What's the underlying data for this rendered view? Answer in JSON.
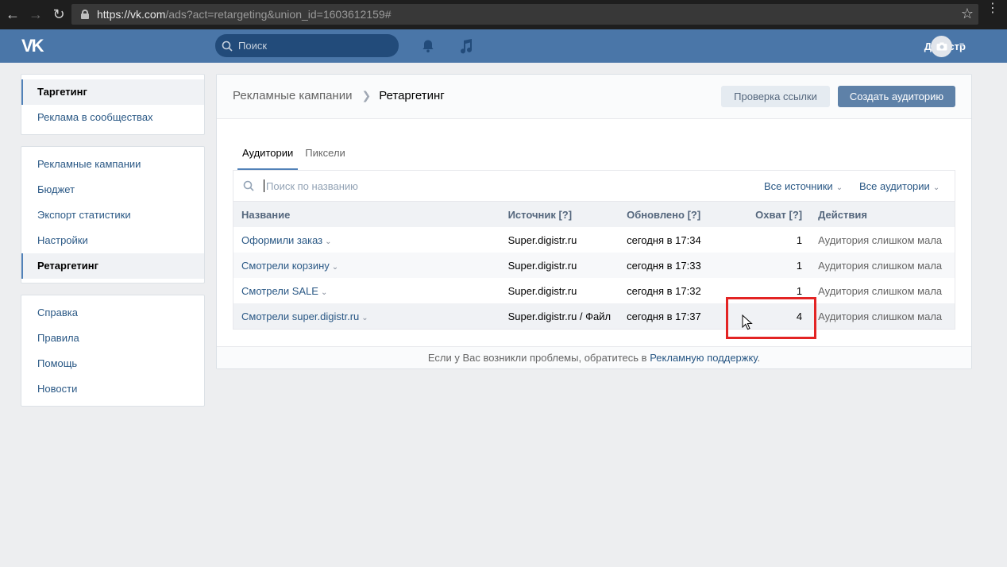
{
  "browser": {
    "url_host": "https://vk.com",
    "url_rest": "/ads?act=retargeting&union_id=1603612159#"
  },
  "header": {
    "logo": "VK",
    "search_placeholder": "Поиск",
    "user_name": "Дигистр"
  },
  "sidebar": {
    "block1": [
      {
        "label": "Таргетинг",
        "active": true
      },
      {
        "label": "Реклама в сообществах",
        "active": false
      }
    ],
    "block2": [
      {
        "label": "Рекламные кампании",
        "active": false
      },
      {
        "label": "Бюджет",
        "active": false
      },
      {
        "label": "Экспорт статистики",
        "active": false
      },
      {
        "label": "Настройки",
        "active": false
      },
      {
        "label": "Ретаргетинг",
        "active": true
      }
    ],
    "block3": [
      {
        "label": "Справка"
      },
      {
        "label": "Правила"
      },
      {
        "label": "Помощь"
      },
      {
        "label": "Новости"
      }
    ]
  },
  "main": {
    "breadcrumb_parent": "Рекламные кампании",
    "breadcrumb_current": "Ретаргетинг",
    "check_link_button": "Проверка ссылки",
    "create_audience_button": "Создать аудиторию",
    "tabs": [
      {
        "label": "Аудитории",
        "active": true
      },
      {
        "label": "Пиксели",
        "active": false
      }
    ],
    "search_placeholder": "Поиск по названию",
    "filter_sources": "Все источники",
    "filter_audiences": "Все аудитории",
    "columns": {
      "name": "Название",
      "source": "Источник [?]",
      "updated": "Обновлено [?]",
      "reach": "Охват [?]",
      "actions": "Действия"
    },
    "rows": [
      {
        "name": "Оформили заказ",
        "source": "Super.digistr.ru",
        "updated": "сегодня в 17:34",
        "reach": "1",
        "actions": "Аудитория слишком мала"
      },
      {
        "name": "Смотрели корзину",
        "source": "Super.digistr.ru",
        "updated": "сегодня в 17:33",
        "reach": "1",
        "actions": "Аудитория слишком мала"
      },
      {
        "name": "Смотрели SALE",
        "source": "Super.digistr.ru",
        "updated": "сегодня в 17:32",
        "reach": "1",
        "actions": "Аудитория слишком мала"
      },
      {
        "name": "Смотрели super.digistr.ru",
        "source": "Super.digistr.ru / Файл",
        "updated": "сегодня в 17:37",
        "reach": "4",
        "actions": "Аудитория слишком мала"
      }
    ],
    "footer_text": "Если у Вас возникли проблемы, обратитесь в ",
    "footer_link": "Рекламную поддержку",
    "footer_end": "."
  }
}
